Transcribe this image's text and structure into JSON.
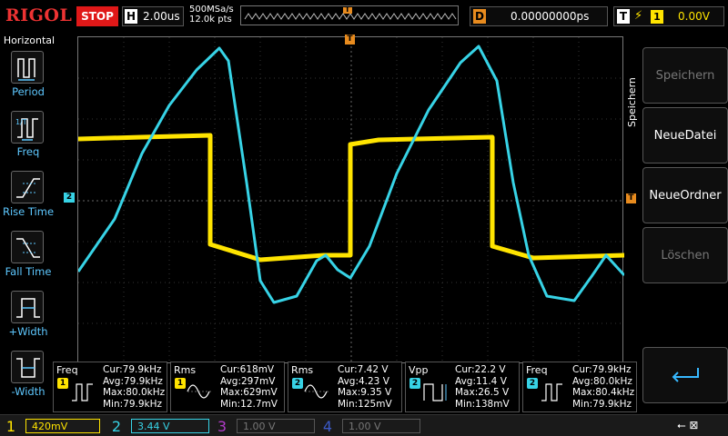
{
  "header": {
    "logo": "RIGOL",
    "run_state": "STOP",
    "timebase": {
      "key": "H",
      "value": "2.00us"
    },
    "sample_rate": "500MSa/s",
    "memory_depth": "12.0k pts",
    "delay": {
      "key": "D",
      "value": "0.00000000ps"
    },
    "trigger": {
      "key": "T",
      "edge": "⚡",
      "source": "1",
      "level": "0.00V"
    },
    "trigger_marker": "T"
  },
  "left_menu": {
    "title": "Horizontal",
    "items": [
      {
        "label": "Period",
        "icon": "period-icon"
      },
      {
        "label": "Freq",
        "icon": "freq-icon"
      },
      {
        "label": "Rise Time",
        "icon": "rise-time-icon"
      },
      {
        "label": "Fall Time",
        "icon": "fall-time-icon"
      },
      {
        "label": "+Width",
        "icon": "positive-width-icon"
      },
      {
        "label": "-Width",
        "icon": "negative-width-icon"
      }
    ]
  },
  "right_menu": {
    "title": "Speichern",
    "buttons": [
      {
        "label": "Speichern",
        "enabled": false
      },
      {
        "label": "NeueDatei",
        "enabled": true
      },
      {
        "label": "NeueOrdner",
        "enabled": true
      },
      {
        "label": "Löschen",
        "enabled": false
      },
      {
        "label": "",
        "icon": "return-icon",
        "enabled": true
      }
    ]
  },
  "markers": {
    "ch2_ground": "2",
    "trigger_level": "T"
  },
  "measurements": [
    {
      "name": "Freq",
      "channel": "1",
      "cur": "Cur:79.9kHz",
      "avg": "Avg:79.9kHz",
      "max": "Max:80.0kHz",
      "min": "Min:79.9kHz"
    },
    {
      "name": "Rms",
      "channel": "1",
      "cur": "Cur:618mV",
      "avg": "Avg:297mV",
      "max": "Max:629mV",
      "min": "Min:12.7mV"
    },
    {
      "name": "Rms",
      "channel": "2",
      "cur": "Cur:7.42 V",
      "avg": "Avg:4.23 V",
      "max": "Max:9.35 V",
      "min": "Min:125mV"
    },
    {
      "name": "Vpp",
      "channel": "2",
      "cur": "Cur:22.2 V",
      "avg": "Avg:11.4 V",
      "max": "Max:26.5 V",
      "min": "Min:138mV"
    },
    {
      "name": "Freq",
      "channel": "2",
      "cur": "Cur:79.9kHz",
      "avg": "Avg:80.0kHz",
      "max": "Max:80.4kHz",
      "min": "Min:79.9kHz"
    }
  ],
  "channels": [
    {
      "num": "1",
      "scale": "420mV",
      "color": "#ffe400",
      "active": true
    },
    {
      "num": "2",
      "scale": "3.44 V",
      "color": "#37d3e6",
      "active": true
    },
    {
      "num": "3",
      "scale": "1.00 V",
      "color": "#b03cc8",
      "active": false
    },
    {
      "num": "4",
      "scale": "1.00 V",
      "color": "#3c5ac8",
      "active": false
    }
  ],
  "status": {
    "usb": "⭠ ⊠"
  },
  "colors": {
    "ch1": "#ffe400",
    "ch2": "#37d3e6",
    "trigger": "#e88b1e",
    "stop": "#e01818",
    "menu_label": "#5ec8ff"
  }
}
